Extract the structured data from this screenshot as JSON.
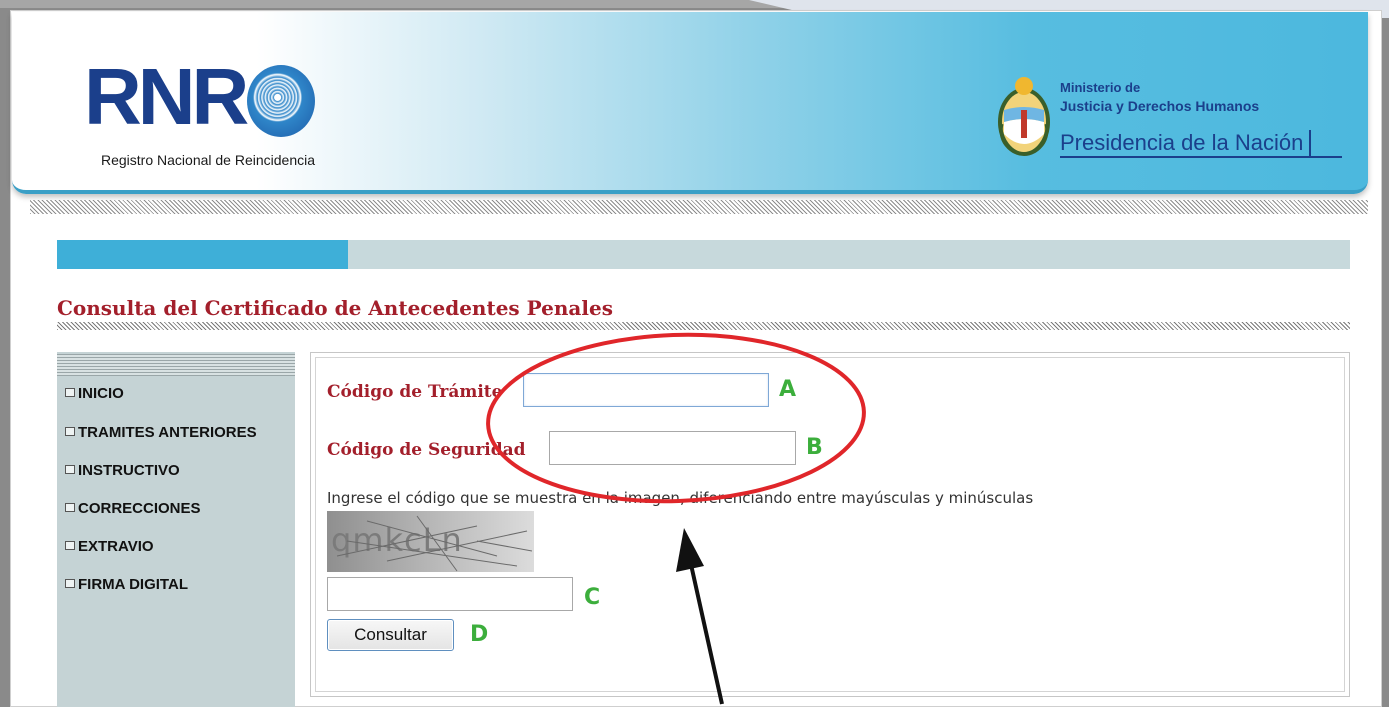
{
  "header": {
    "logo_text": "RNR",
    "logo_subtitle": "Registro Nacional de Reincidencia",
    "ministry_line1": "Ministerio de",
    "ministry_line2": "Justicia y Derechos Humanos",
    "ministry_line3": "Presidencia de la Nación"
  },
  "progress": {
    "value": 0.225
  },
  "page": {
    "title": "Consulta del Certificado de Antecedentes Penales"
  },
  "sidebar": {
    "items": [
      {
        "label": "INICIO"
      },
      {
        "label": "TRAMITES ANTERIORES"
      },
      {
        "label": "INSTRUCTIVO"
      },
      {
        "label": "CORRECCIONES"
      },
      {
        "label": "EXTRAVIO"
      },
      {
        "label": "FIRMA DIGITAL"
      }
    ]
  },
  "form": {
    "codigo_tramite_label": "Código de Trámite",
    "codigo_tramite_value": "",
    "codigo_seguridad_label": "Código de Seguridad",
    "codigo_seguridad_value": "",
    "instructions": "Ingrese el código que se muestra en la imagen, diferenciando entre mayúsculas y minúsculas",
    "captcha_text": "qmkcLn",
    "captcha_value": "",
    "submit_label": "Consultar"
  },
  "annotations": {
    "marker_a": "A",
    "marker_b": "B",
    "marker_c": "C",
    "marker_d": "D",
    "marker_color": "#3cae3c",
    "circle_color": "#e0262a"
  },
  "colors": {
    "brand_blue": "#1b3f8b",
    "header_blue": "#4cb8de",
    "title_red": "#a31f2b",
    "sidebar_bg": "#c5d3d5"
  }
}
